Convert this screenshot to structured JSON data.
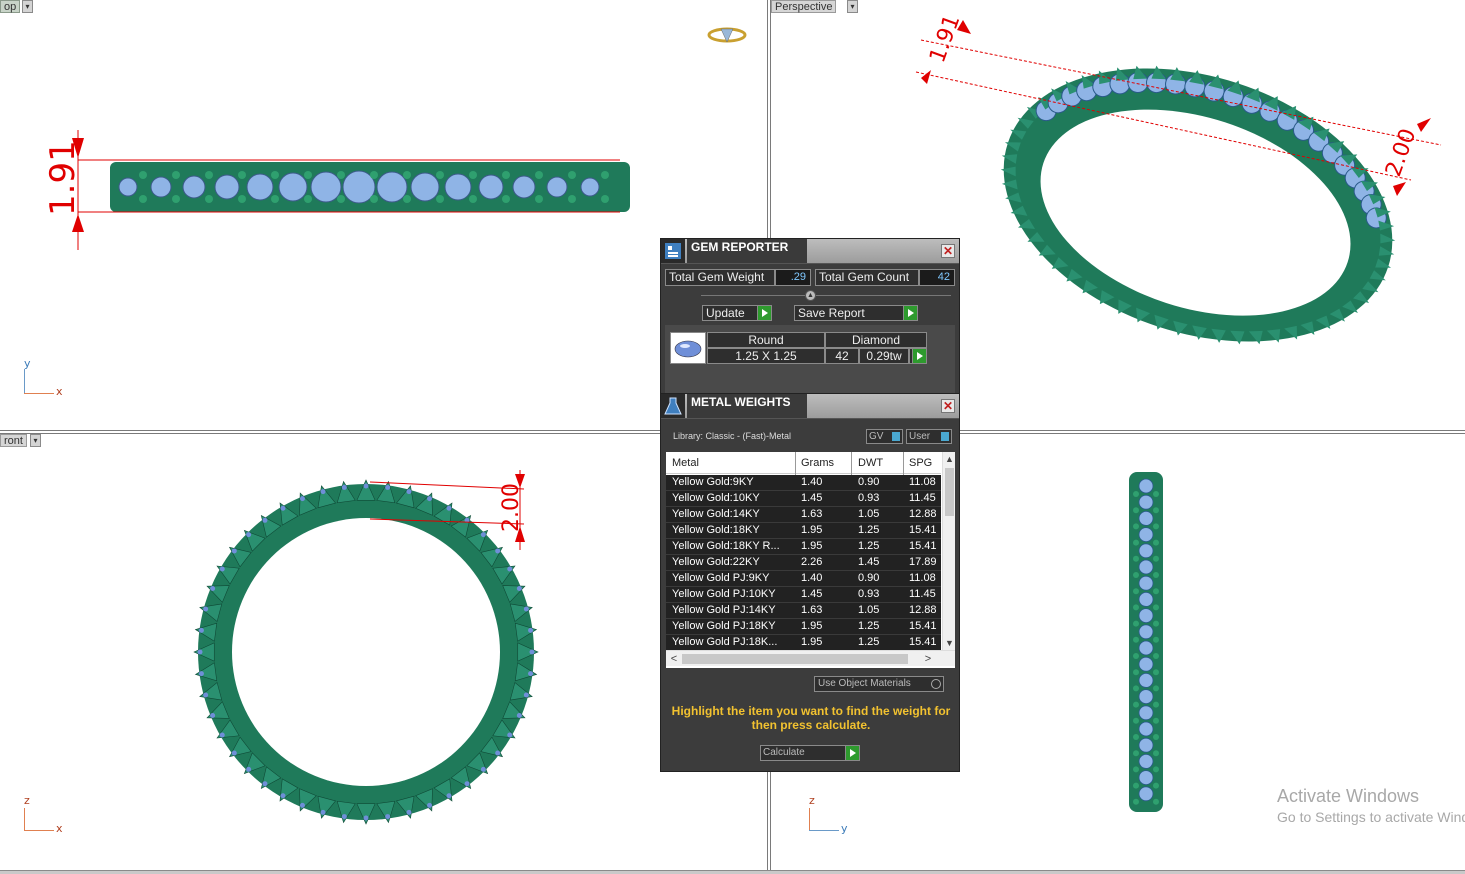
{
  "viewports": {
    "top_left_label": "op",
    "top_right_label": "Perspective",
    "bottom_left_label": "ront"
  },
  "axes": {
    "tl": {
      "v": "y",
      "h": "x"
    },
    "bl": {
      "v": "z",
      "h": "x"
    },
    "br": {
      "v": "z",
      "h": "y"
    }
  },
  "dimensions": {
    "top_height": "1.91",
    "persp_height": "1.91",
    "persp_width": "2.00",
    "front_width": "2.00"
  },
  "watermark": {
    "line1": "Activate Windows",
    "line2": "Go to Settings to activate Windows."
  },
  "gem_reporter": {
    "title": "GEM REPORTER",
    "total_weight_label": "Total Gem Weight",
    "total_weight_value": ".29",
    "total_count_label": "Total Gem Count",
    "total_count_value": "42",
    "update_label": "Update",
    "save_label": "Save Report",
    "gem": {
      "shape": "Round",
      "material": "Diamond",
      "size": "1.25 X 1.25",
      "count": "42",
      "weight": "0.29tw"
    }
  },
  "metal_weights": {
    "title": "METAL WEIGHTS",
    "library": "Library: Classic - (Fast)-Metal",
    "toggle_gv": "GV",
    "toggle_user": "User",
    "columns": [
      "Metal",
      "Grams",
      "DWT",
      "SPG"
    ],
    "rows": [
      {
        "metal": "Yellow Gold:9KY",
        "grams": "1.40",
        "dwt": "0.90",
        "spg": "11.08"
      },
      {
        "metal": "Yellow Gold:10KY",
        "grams": "1.45",
        "dwt": "0.93",
        "spg": "11.45"
      },
      {
        "metal": "Yellow Gold:14KY",
        "grams": "1.63",
        "dwt": "1.05",
        "spg": "12.88"
      },
      {
        "metal": "Yellow Gold:18KY",
        "grams": "1.95",
        "dwt": "1.25",
        "spg": "15.41"
      },
      {
        "metal": "Yellow Gold:18KY R...",
        "grams": "1.95",
        "dwt": "1.25",
        "spg": "15.41"
      },
      {
        "metal": "Yellow Gold:22KY",
        "grams": "2.26",
        "dwt": "1.45",
        "spg": "17.89"
      },
      {
        "metal": "Yellow Gold PJ:9KY",
        "grams": "1.40",
        "dwt": "0.90",
        "spg": "11.08"
      },
      {
        "metal": "Yellow Gold PJ:10KY",
        "grams": "1.45",
        "dwt": "0.93",
        "spg": "11.45"
      },
      {
        "metal": "Yellow Gold PJ:14KY",
        "grams": "1.63",
        "dwt": "1.05",
        "spg": "12.88"
      },
      {
        "metal": "Yellow Gold PJ:18KY",
        "grams": "1.95",
        "dwt": "1.25",
        "spg": "15.41"
      },
      {
        "metal": "Yellow Gold PJ:18K...",
        "grams": "1.95",
        "dwt": "1.25",
        "spg": "15.41"
      }
    ],
    "use_object_materials": "Use Object Materials",
    "hint": "Highlight the item you want to find the weight for then press calculate.",
    "calculate_label": "Calculate"
  },
  "colors": {
    "ring_green": "#1f7a5a",
    "gem_blue": "#8fb4e6",
    "dimension_red": "#e00000",
    "hint_yellow": "#f2c230"
  }
}
